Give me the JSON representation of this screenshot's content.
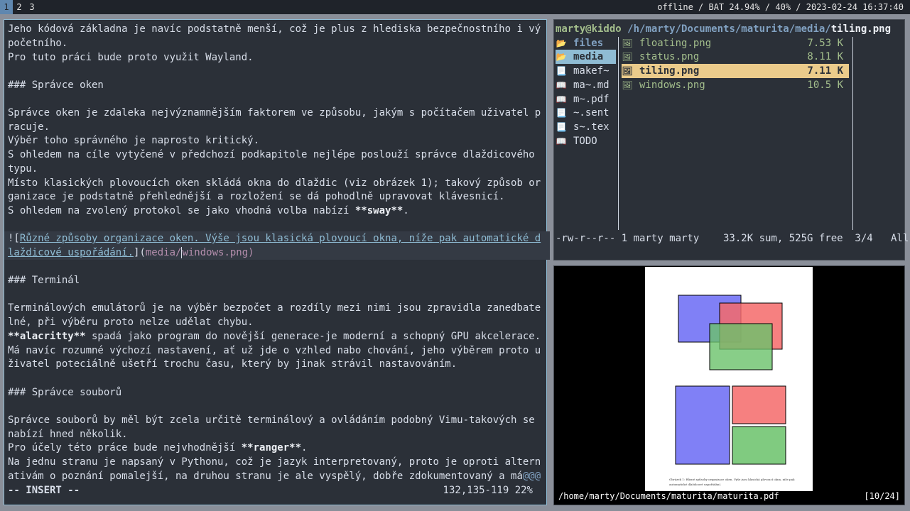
{
  "topbar": {
    "workspaces": [
      "1",
      "2",
      "3"
    ],
    "status": "offline / BAT 24.94% / 40% / 2023-02-24 16:37:40"
  },
  "editor": {
    "lines": [
      "Jeho kódová základna je navíc podstatně menší, což je plus z hlediska bezpečnostního i vý",
      "početního.",
      "Pro tuto práci bude proto využit Wayland.",
      "",
      "### Správce oken",
      "",
      "Správce oken je zdaleka nejvýznamnějším faktorem ve způsobu, jakým s počítačem uživatel p",
      "racuje.",
      "Výběr toho správného je naprosto kritický.",
      "S ohledem na cíle vytyčené v předchozí podkapitole nejlépe poslouží správce dlaždicového",
      "typu.",
      "Místo klasických plovoucích oken skládá okna do dlaždic (viz obrázek 1); takový způsob or",
      "ganizace je podstatně přehlednější a rozložení se dá pohodlně upravovat klávesnicí.",
      "S ohledem na zvolený protokol se jako vhodná volba nabízí ",
      "",
      "![",
      "laždicové uspořádání.",
      "",
      "### Terminál",
      "",
      "Terminálových emulátorů je na výběr bezpočet a rozdíly mezi nimi jsou zpravidla zanedbate",
      "lné, při výběru proto nelze udělat chybu.",
      " spadá jako program do novější generace-je moderní a schopný GPU akcelerace.",
      "Má navíc rozumné výchozí nastavení, ať už jde o vzhled nabo chování, jeho výběrem proto u",
      "živatel poteciálně ušetří trochu času, který by jinak strávil nastavováním.",
      "",
      "### Správce souborů",
      "",
      "Správce souborů by měl být zcela určitě terminálový a ovládáním podobný Vimu-takových se",
      "nabízí hned několik.",
      "Pro účely této práce bude nejvhodnější ",
      "Na jednu stranu je napsaný v Pythonu, což je jazyk interpretovaný, proto je oproti altern",
      "ativám o poznání pomalejší, na druhou stranu je ale vyspělý, dobře zdokumentovaný a má"
    ],
    "bold_sway": "**sway**",
    "bold_alacritty": "**alacritty**",
    "bold_ranger": "**ranger**",
    "link_text_1": "Různé způsoby organizace oken. Výše jsou klasická plovoucí okna, níže pak automatické d",
    "link_text_2_prefix": "d",
    "link_close": "](",
    "url_part1": "media/",
    "url_part2": "windows.png)",
    "overflow_marker": "@@@",
    "mode": "-- INSERT --",
    "position": "132,135-119",
    "percent": "22%"
  },
  "ranger": {
    "path_user": "marty@kiddo",
    "path_dir": "/h/marty/Documents/maturita/media/",
    "path_file": "tiling.png",
    "parent_items": [
      {
        "icon": "folder-icon",
        "label": "files",
        "kind": "dir"
      },
      {
        "icon": "folder-open-icon",
        "label": "media",
        "kind": "selected"
      },
      {
        "icon": "file-icon",
        "label": "makef~",
        "kind": "file"
      },
      {
        "icon": "book-icon",
        "label": "ma~.md",
        "kind": "file"
      },
      {
        "icon": "book-icon",
        "label": "m~.pdf",
        "kind": "file"
      },
      {
        "icon": "file-icon",
        "label": "~.sent",
        "kind": "file"
      },
      {
        "icon": "file-icon",
        "label": "s~.tex",
        "kind": "file"
      },
      {
        "icon": "book-icon",
        "label": "TODO",
        "kind": "file"
      }
    ],
    "files": [
      {
        "name": "floating.png",
        "size": "7.53 K",
        "selected": false
      },
      {
        "name": "status.png",
        "size": "8.11 K",
        "selected": false
      },
      {
        "name": "tiling.png",
        "size": "7.11 K",
        "selected": true
      },
      {
        "name": "windows.png",
        "size": "10.5 K",
        "selected": false
      }
    ],
    "status": "-rw-r--r-- 1 marty marty    33.2K sum, 525G free  3/4   All"
  },
  "viewer": {
    "path": "/home/marty/Documents/maturita/maturita.pdf",
    "page": "[10/24]",
    "caption_line1": "Obrázek 1: Různé způsoby organizace oken. Výše jsou klasická plovoucí okna, níže pak",
    "caption_line2": "automatické dlaždicové uspořádání.",
    "colors": {
      "blue": "#6a6af5",
      "red": "#f56a6a",
      "green": "#6ac26a"
    }
  }
}
